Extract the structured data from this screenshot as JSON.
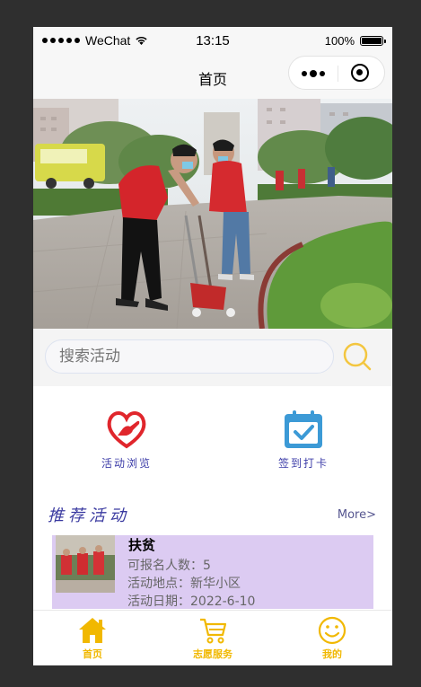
{
  "status_bar": {
    "carrier": "WeChat",
    "time": "13:15",
    "battery": "100%"
  },
  "navbar": {
    "title": "首页"
  },
  "search": {
    "placeholder": "搜索活动"
  },
  "entries": [
    {
      "label": "活动浏览",
      "icon": "heart-hand-icon"
    },
    {
      "label": "签到打卡",
      "icon": "calendar-check-icon"
    }
  ],
  "section": {
    "title": "推荐活动",
    "more": "More>"
  },
  "activity": {
    "name": "扶贫",
    "slots": "可报名人数：5",
    "location": "活动地点：新华小区",
    "date": "活动日期：2022-6-10"
  },
  "tabs": [
    {
      "label": "首页",
      "icon": "home-icon"
    },
    {
      "label": "志愿服务",
      "icon": "cart-icon"
    },
    {
      "label": "我的",
      "icon": "smile-icon"
    }
  ],
  "colors": {
    "accent": "#f1b800",
    "card_bg": "#dccbf2",
    "entry_text": "#3c3ca8"
  }
}
